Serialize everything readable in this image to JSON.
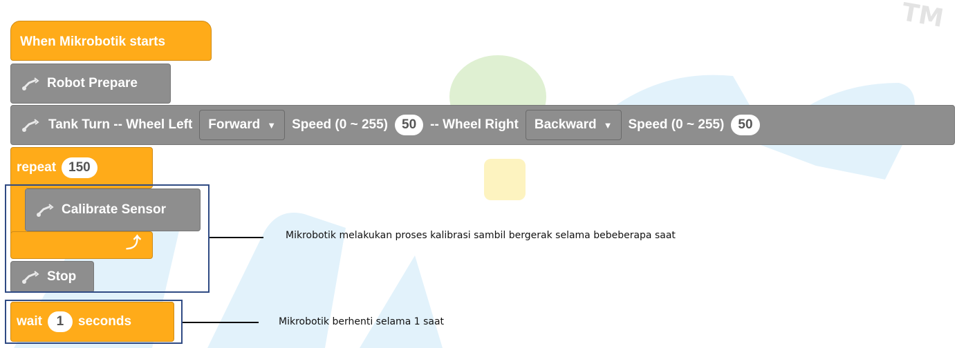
{
  "watermark": {
    "tm": "TM"
  },
  "blocks": {
    "event": {
      "label": "When Mikrobotik starts"
    },
    "prepare": {
      "label": "Robot Prepare"
    },
    "tank": {
      "label": "Tank Turn -- Wheel Left",
      "left_dir": "Forward",
      "speed_label_1": "Speed (0 ~ 255)",
      "speed_1": "50",
      "wheel_right_label": "-- Wheel Right",
      "right_dir": "Backward",
      "speed_label_2": "Speed (0 ~ 255)",
      "speed_2": "50"
    },
    "repeat": {
      "label": "repeat",
      "count": "150"
    },
    "calibrate": {
      "label": "Calibrate Sensor"
    },
    "stop": {
      "label": "Stop"
    },
    "wait": {
      "label": "wait",
      "value": "1",
      "unit": "seconds"
    }
  },
  "annotations": {
    "note1": "Mikrobotik melakukan proses kalibrasi sambil bergerak selama bebeberapa saat",
    "note2": "Mikrobotik berhenti selama 1 saat"
  },
  "colors": {
    "event": "#ffab19",
    "gray": "#8e8e8e",
    "box": "#2f4a83"
  }
}
